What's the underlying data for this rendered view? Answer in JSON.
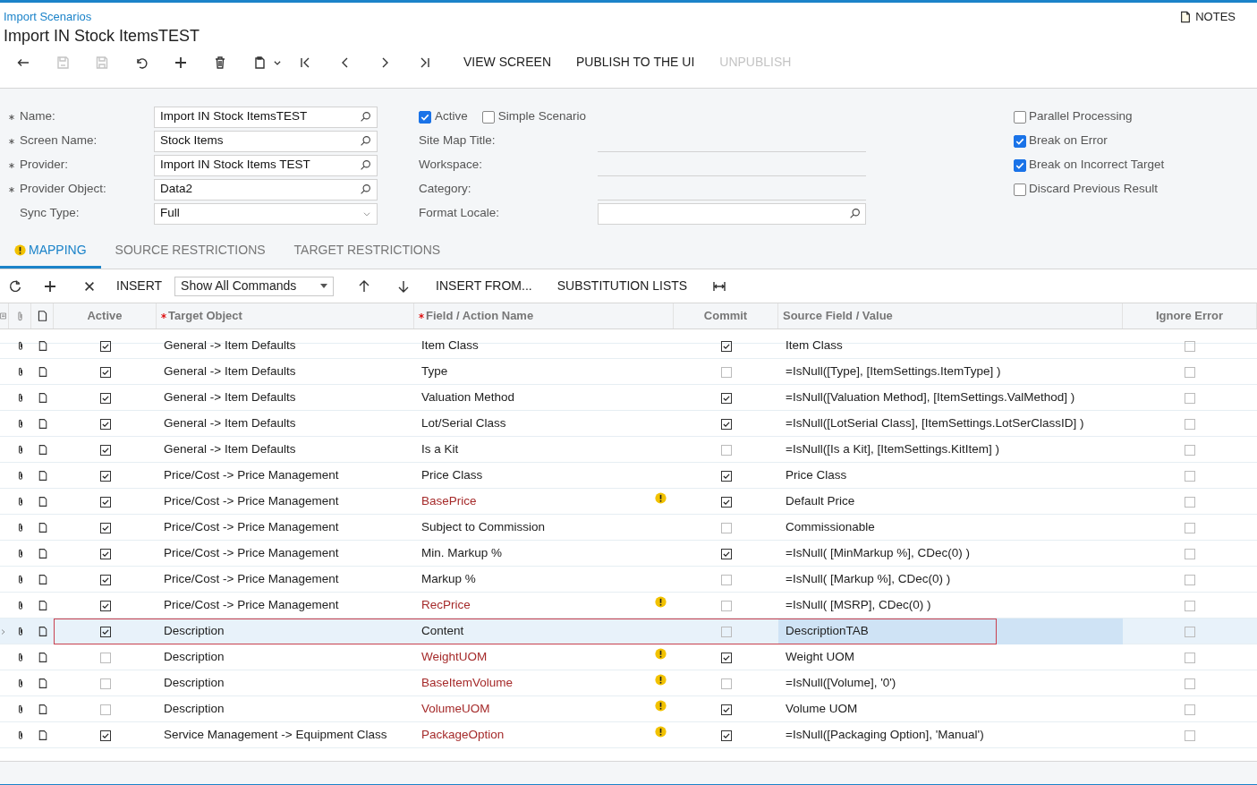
{
  "breadcrumb": "Import Scenarios",
  "title": "Import IN Stock ItemsTEST",
  "notes": "NOTES",
  "toolbar": {
    "icon_buttons": [
      {
        "kind": "back",
        "disabled": false
      },
      {
        "kind": "save-close",
        "disabled": true
      },
      {
        "kind": "save",
        "disabled": true
      },
      {
        "kind": "undo",
        "disabled": false
      },
      {
        "kind": "add",
        "disabled": false
      },
      {
        "kind": "delete",
        "disabled": false
      },
      {
        "kind": "copy-paste",
        "disabled": false
      },
      {
        "kind": "first",
        "disabled": false
      },
      {
        "kind": "prev",
        "disabled": false
      },
      {
        "kind": "next",
        "disabled": false
      },
      {
        "kind": "last",
        "disabled": false
      }
    ],
    "text_buttons": [
      {
        "label": "VIEW SCREEN",
        "disabled": false
      },
      {
        "label": "PUBLISH TO THE UI",
        "disabled": false
      },
      {
        "label": "UNPUBLISH",
        "disabled": true
      }
    ]
  },
  "form": {
    "left": [
      {
        "label": "Name:",
        "required": true,
        "value": "Import IN Stock ItemsTEST",
        "kind": "lookup"
      },
      {
        "label": "Screen Name:",
        "required": true,
        "value": "Stock Items",
        "kind": "lookup"
      },
      {
        "label": "Provider:",
        "required": true,
        "value": "Import IN Stock Items TEST",
        "kind": "lookup"
      },
      {
        "label": "Provider Object:",
        "required": true,
        "value": "Data2",
        "kind": "lookup"
      },
      {
        "label": "Sync Type:",
        "required": false,
        "value": "Full",
        "kind": "select"
      }
    ],
    "middle_checks": [
      {
        "label": "Active",
        "checked": true
      },
      {
        "label": "Simple Scenario",
        "checked": false
      }
    ],
    "middle": [
      {
        "label": "Site Map Title:",
        "kind": "line"
      },
      {
        "label": "Workspace:",
        "kind": "line"
      },
      {
        "label": "Category:",
        "kind": "line"
      },
      {
        "label": "Format Locale:",
        "kind": "lookup"
      }
    ],
    "right_checks": [
      {
        "label": "Parallel Processing",
        "checked": false
      },
      {
        "label": "Break on Error",
        "checked": true
      },
      {
        "label": "Break on Incorrect Target",
        "checked": true
      },
      {
        "label": "Discard Previous Result",
        "checked": false
      }
    ]
  },
  "tabs": [
    {
      "label": "MAPPING",
      "selected": true,
      "warning": true
    },
    {
      "label": "SOURCE RESTRICTIONS",
      "selected": false,
      "warning": false
    },
    {
      "label": "TARGET RESTRICTIONS",
      "selected": false,
      "warning": false
    }
  ],
  "grid_toolbar": {
    "insert": "INSERT",
    "filter": "Show All Commands",
    "insert_from": "INSERT FROM...",
    "substitution_lists": "SUBSTITUTION LISTS"
  },
  "columns": [
    {
      "label": "Active",
      "required": false
    },
    {
      "label": "Target Object",
      "required": true
    },
    {
      "label": "Field / Action Name",
      "required": true
    },
    {
      "label": "Commit",
      "required": false
    },
    {
      "label": "Source Field / Value",
      "required": false
    },
    {
      "label": "Ignore Error",
      "required": false
    }
  ],
  "rows": [
    {
      "active": true,
      "target": "General -> Item Defaults",
      "field": "Item Class",
      "warning": false,
      "commit": true,
      "source": "Item Class",
      "ignore_error": false,
      "selected": false
    },
    {
      "active": true,
      "target": "General -> Item Defaults",
      "field": "Type",
      "warning": false,
      "commit": false,
      "source": "=IsNull([Type], [ItemSettings.ItemType] )",
      "ignore_error": false,
      "selected": false
    },
    {
      "active": true,
      "target": "General -> Item Defaults",
      "field": "Valuation Method",
      "warning": false,
      "commit": true,
      "source": "=IsNull([Valuation Method], [ItemSettings.ValMethod] )",
      "ignore_error": false,
      "selected": false
    },
    {
      "active": true,
      "target": "General -> Item Defaults",
      "field": "Lot/Serial Class",
      "warning": false,
      "commit": true,
      "source": "=IsNull([LotSerial Class], [ItemSettings.LotSerClassID] )",
      "ignore_error": false,
      "selected": false
    },
    {
      "active": true,
      "target": "General -> Item Defaults",
      "field": "Is a Kit",
      "warning": false,
      "commit": false,
      "source": "=IsNull([Is a Kit], [ItemSettings.KitItem] )",
      "ignore_error": false,
      "selected": false
    },
    {
      "active": true,
      "target": "Price/Cost -> Price Management",
      "field": "Price Class",
      "warning": false,
      "commit": true,
      "source": "Price Class",
      "ignore_error": false,
      "selected": false
    },
    {
      "active": true,
      "target": "Price/Cost -> Price Management",
      "field": "BasePrice",
      "warning": true,
      "commit": true,
      "source": "Default Price",
      "ignore_error": false,
      "selected": false
    },
    {
      "active": true,
      "target": "Price/Cost -> Price Management",
      "field": "Subject to Commission",
      "warning": false,
      "commit": false,
      "source": "Commissionable",
      "ignore_error": false,
      "selected": false
    },
    {
      "active": true,
      "target": "Price/Cost -> Price Management",
      "field": "Min. Markup %",
      "warning": false,
      "commit": true,
      "source": "=IsNull( [MinMarkup %], CDec(0) )",
      "ignore_error": false,
      "selected": false
    },
    {
      "active": true,
      "target": "Price/Cost -> Price Management",
      "field": "Markup %",
      "warning": false,
      "commit": false,
      "source": "=IsNull( [Markup %], CDec(0) )",
      "ignore_error": false,
      "selected": false
    },
    {
      "active": true,
      "target": "Price/Cost -> Price Management",
      "field": "RecPrice",
      "warning": true,
      "commit": false,
      "source": "=IsNull( [MSRP], CDec(0) )",
      "ignore_error": false,
      "selected": false
    },
    {
      "active": true,
      "target": "Description",
      "field": "Content",
      "warning": false,
      "commit": false,
      "source": "DescriptionTAB",
      "ignore_error": false,
      "selected": true
    },
    {
      "active": false,
      "target": "Description",
      "field": "WeightUOM",
      "warning": true,
      "commit": true,
      "source": "Weight UOM",
      "ignore_error": false,
      "selected": false
    },
    {
      "active": false,
      "target": "Description",
      "field": "BaseItemVolume",
      "warning": true,
      "commit": false,
      "source": "=IsNull([Volume], '0')",
      "ignore_error": false,
      "selected": false
    },
    {
      "active": false,
      "target": "Description",
      "field": "VolumeUOM",
      "warning": true,
      "commit": true,
      "source": "Volume UOM",
      "ignore_error": false,
      "selected": false
    },
    {
      "active": true,
      "target": "Service Management -> Equipment Class",
      "field": "PackageOption",
      "warning": true,
      "commit": true,
      "source": "=IsNull([Packaging Option], 'Manual')",
      "ignore_error": false,
      "selected": false
    }
  ]
}
